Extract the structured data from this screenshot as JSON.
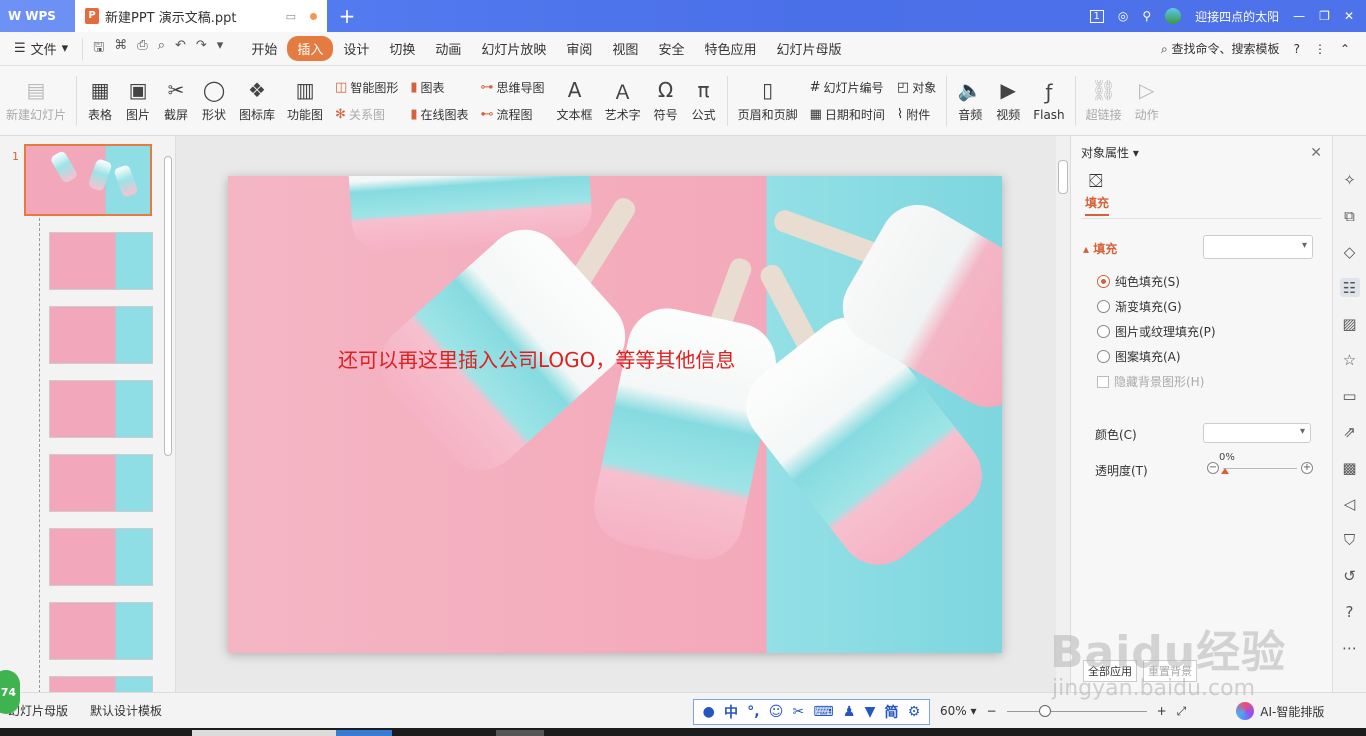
{
  "titlebar": {
    "app_label": "WPS",
    "doc_title": "新建PPT 演示文稿.ppt",
    "badge": "1",
    "user_name": "迎接四点的太阳"
  },
  "menubar": {
    "file_label": "文件",
    "items": [
      "开始",
      "插入",
      "设计",
      "切换",
      "动画",
      "幻灯片放映",
      "审阅",
      "视图",
      "安全",
      "特色应用",
      "幻灯片母版"
    ],
    "active": "插入",
    "search_label": "查找命令、搜索模板"
  },
  "ribbon": {
    "new_slide": "新建幻灯片",
    "table": "表格",
    "picture": "图片",
    "screenshot": "截屏",
    "shape": "形状",
    "icon_lib": "图标库",
    "func_chart": "功能图",
    "smart_shape": "智能图形",
    "relation": "关系图",
    "chart": "图表",
    "online_chart": "在线图表",
    "mindmap": "思维导图",
    "flowchart": "流程图",
    "textbox": "文本框",
    "wordart": "艺术字",
    "symbol": "符号",
    "formula": "公式",
    "header_footer": "页眉和页脚",
    "slide_number": "幻灯片编号",
    "datetime": "日期和时间",
    "object": "对象",
    "attachment": "附件",
    "audio": "音频",
    "video": "视频",
    "flash": "Flash",
    "hyperlink": "超链接",
    "action": "动作"
  },
  "thumbnails": {
    "first_slide_number": "1"
  },
  "slide": {
    "text": "还可以再这里插入公司LOGO，等等其他信息"
  },
  "properties": {
    "panel_title": "对象属性",
    "tab_fill": "填充",
    "section_fill": "填充",
    "options": [
      "纯色填充(S)",
      "渐变填充(G)",
      "图片或纹理填充(P)",
      "图案填充(A)"
    ],
    "selected_option": 0,
    "hide_bg": "隐藏背景图形(H)",
    "color_label": "颜色(C)",
    "transparency_label": "透明度(T)",
    "transparency_value": "0%",
    "apply_all": "全部应用",
    "reset_bg": "重置背景"
  },
  "status": {
    "master": "幻灯片母版",
    "template": "默认设计模板",
    "zoom": "60%",
    "ai": "AI-智能排版",
    "ime_chars": [
      "中",
      "简"
    ],
    "green_badge": "74"
  },
  "watermark": {
    "brand": "Baidu经验",
    "url": "jingyan.baidu.com"
  },
  "colors": {
    "accent": "#e47c41",
    "titlebar": "#4a6fe8",
    "slide_pink": "#f3a9ba",
    "slide_cyan": "#93e0e6",
    "slide_text": "#e02020"
  }
}
